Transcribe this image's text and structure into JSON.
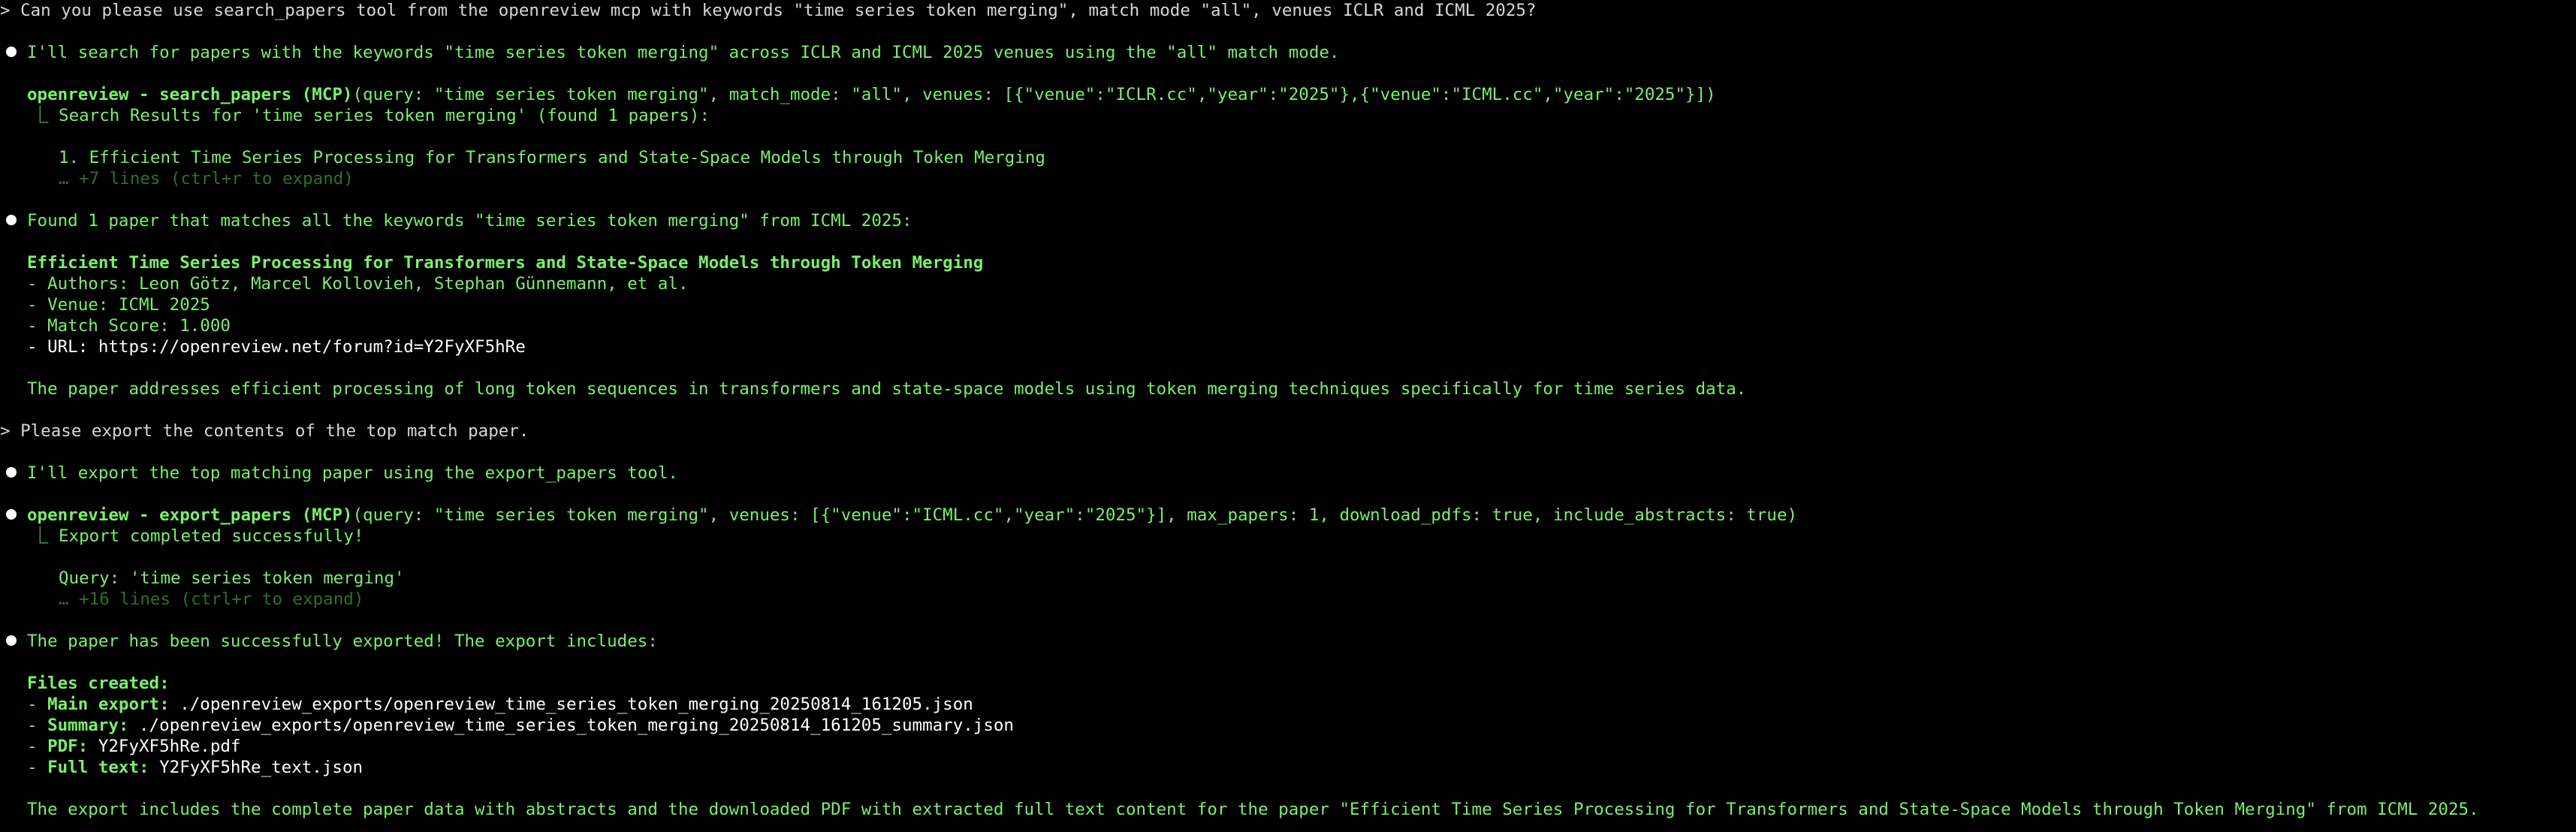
{
  "colors": {
    "background": "#000000",
    "assistant_text": "#7af06a",
    "user_text": "#d6d6d6",
    "dim_text": "#2f6f2a",
    "bullet": "#ffffff"
  },
  "prompt1": {
    "prefix": ">",
    "text": "Can you please use search_papers tool from the openreview mcp with keywords \"time series token merging\", match mode \"all\", venues ICLR and ICML 2025?"
  },
  "msg1": "I'll search for papers with the keywords \"time series token merging\" across ICLR and ICML 2025 venues using the \"all\" match mode.",
  "tool1": {
    "name": "openreview - search_papers (MCP)",
    "args": "(query: \"time series token merging\", match_mode: \"all\", venues: [{\"venue\":\"ICLR.cc\",\"year\":\"2025\"},{\"venue\":\"ICML.cc\",\"year\":\"2025\"}])",
    "result_header": "⎿ Search Results for 'time series token merging' (found 1 papers):",
    "result_item": "1. Efficient Time Series Processing for Transformers and State-Space Models through Token Merging",
    "expand": "… +7 lines (ctrl+r to expand)"
  },
  "msg2": "Found 1 paper that matches all the keywords \"time series token merging\" from ICML 2025:",
  "paper": {
    "title": "Efficient Time Series Processing for Transformers and State-Space Models through Token Merging",
    "authors": "- Authors: Leon Götz, Marcel Kollovieh, Stephan Günnemann, et al.",
    "venue": "- Venue: ICML 2025",
    "score": "- Match Score: 1.000",
    "url": "- URL: https://openreview.net/forum?id=Y2FyXF5hRe",
    "summary": "The paper addresses efficient processing of long token sequences in transformers and state-space models using token merging techniques specifically for time series data."
  },
  "prompt2": {
    "prefix": ">",
    "text": "Please export the contents of the top match paper."
  },
  "msg3": "I'll export the top matching paper using the export_papers tool.",
  "tool2": {
    "name": "openreview - export_papers (MCP)",
    "args": "(query: \"time series token merging\", venues: [{\"venue\":\"ICML.cc\",\"year\":\"2025\"}], max_papers: 1, download_pdfs: true, include_abstracts: true)",
    "result_header": "⎿ Export completed successfully!",
    "query_line": "Query: 'time series token merging'",
    "expand": "… +16 lines (ctrl+r to expand)"
  },
  "msg4": "The paper has been successfully exported! The export includes:",
  "files": {
    "heading": "Files created:",
    "main_label": "Main export:",
    "main_value": " ./openreview_exports/openreview_time_series_token_merging_20250814_161205.json",
    "summary_label": "Summary:",
    "summary_value": " ./openreview_exports/openreview_time_series_token_merging_20250814_161205_summary.json",
    "pdf_label": "PDF:",
    "pdf_value": " Y2FyXF5hRe.pdf",
    "fulltext_label": "Full text:",
    "fulltext_value": " Y2FyXF5hRe_text.json"
  },
  "msg5": "The export includes the complete paper data with abstracts and the downloaded PDF with extracted full text content for the paper \"Efficient Time Series Processing for Transformers and State-Space Models through Token Merging\" from ICML 2025."
}
